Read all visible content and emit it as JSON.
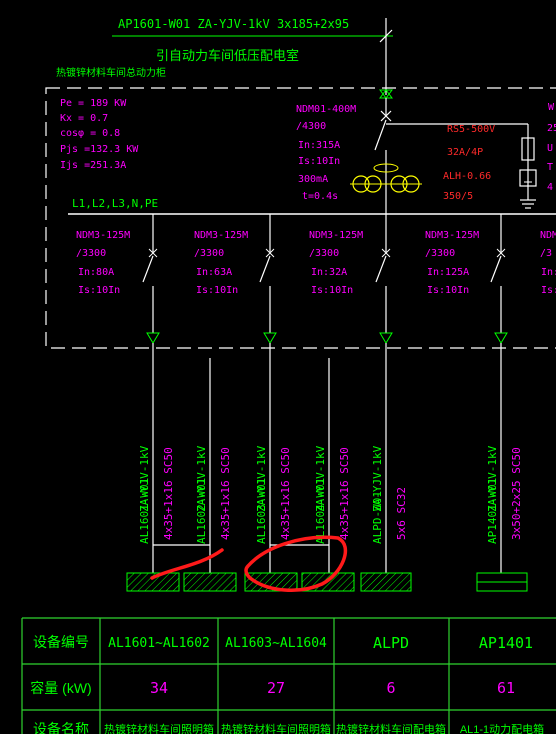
{
  "colors": {
    "background": "#000000",
    "green": "#00ff00",
    "white": "#ffffff",
    "magenta": "#ff00ff",
    "red": "#ff2a2a",
    "yellow": "#ffff00",
    "table_green": "#2fd32f"
  },
  "incoming": {
    "cable": "AP1601-W01  ZA-YJV-1kV  3x185+2x95",
    "source_note": "引自动力车间低压配电室"
  },
  "panel": {
    "name": "热镀锌材料车间总动力柜",
    "params": [
      "Pe = 189 KW",
      "Kx = 0.7",
      "cosφ = 0.8",
      "Pjs =132.3 KW",
      "Ijs =251.3A"
    ],
    "bus_label": "L1,L2,L3,N,PE",
    "main_breaker": [
      "NDM01-400M",
      "/4300",
      "In:315A",
      "Is:10In",
      "300mA",
      "t=0.4s"
    ],
    "spd": [
      "RS5-500V",
      "32A/4P",
      "ALH-0.66",
      "350/5"
    ],
    "right_edge_partial": [
      "W",
      "25",
      "U",
      "T",
      "4"
    ]
  },
  "feeders": [
    {
      "breaker": [
        "NDM3-125M",
        "/3300",
        "In:80A",
        "Is:10In"
      ],
      "cable_id": "AL1601-W01",
      "cable_type": "ZA-YJV-1kV",
      "cable_spec": "4x35+1x16  SC50"
    },
    {
      "breaker": [
        "NDM3-125M",
        "/3300",
        "In:63A",
        "Is:10In"
      ],
      "cable_id": "AL1602-W01",
      "cable_type": "ZA-YJV-1kV",
      "cable_spec": "4x35+1x16  SC50"
    },
    {
      "breaker": [],
      "cable_id": "AL1603-W01",
      "cable_type": "ZA-YJV-1kV",
      "cable_spec": "4x35+1x16  SC50"
    },
    {
      "breaker": [
        "NDM3-125M",
        "/3300",
        "In:32A",
        "Is:10In"
      ],
      "cable_id": "AL1604-W01",
      "cable_type": "ZA-YJV-1kV",
      "cable_spec": "4x35+1x16  SC50"
    },
    {
      "breaker": [],
      "cable_id": "ALPD-W01",
      "cable_type": "ZA-YJV-1kV",
      "cable_spec": "5x6  SC32"
    },
    {
      "breaker": [
        "NDM3-125M",
        "/3300",
        "In:125A",
        "Is:10In"
      ],
      "cable_id": "AP1401-W01",
      "cable_type": "ZA-YJV-1kV",
      "cable_spec": "3x50+2x25  SC50"
    },
    {
      "breaker": [
        "NDM",
        "/3",
        "In:1",
        "Is:1"
      ],
      "cable_id": "",
      "cable_type": "",
      "cable_spec": ""
    }
  ],
  "table": {
    "row_labels": [
      "设备编号",
      "容量 (kW)",
      "设备名称"
    ],
    "columns": [
      {
        "id": "AL1601~AL1602",
        "capacity": "34",
        "name": "热镀锌材料车间照明箱"
      },
      {
        "id": "AL1603~AL1604",
        "capacity": "27",
        "name": "热镀锌材料车间照明箱"
      },
      {
        "id": "ALPD",
        "capacity": "6",
        "name": "热镀锌材料车间配电箱"
      },
      {
        "id": "AP1401",
        "capacity": "61",
        "name": "AL1-1动力配电箱"
      }
    ]
  }
}
